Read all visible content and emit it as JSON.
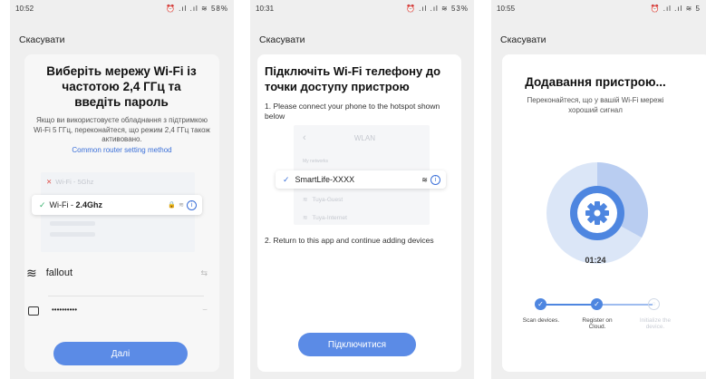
{
  "screen1": {
    "status_time": "10:52",
    "status_icons": "⏰ .ıl .ıl ≋ 58%",
    "cancel": "Скасувати",
    "title": "Виберіть мережу Wi-Fi із частотою 2,4 ГГц та введіть пароль",
    "description": "Якщо ви використовуєте обладнання з підтримкою Wi-Fi 5 ГГц, переконайтеся, що режим 2,4 ГГц також активовано.",
    "router_link": "Common router setting method",
    "wifi_5g_label": "Wi-Fi - 5Ghz",
    "wifi_24g_prefix": "Wi-Fi - ",
    "wifi_24g_band": "2.4Ghz",
    "ssid_value": "fallout",
    "password_value": "••••••••••",
    "next_button": "Далі"
  },
  "screen2": {
    "status_time": "10:31",
    "status_icons": "⏰ .ıl .ıl ≋ 53%",
    "cancel": "Скасувати",
    "title": "Підключіть Wi-Fi телефону до точки доступу пристрою",
    "step1": "1. Please connect your phone to the hotspot shown below",
    "wlan_header": "WLAN",
    "my_networks": "My networks",
    "hotspot_name": "SmartLife-XXXX",
    "network_2": "Tuya-Guest",
    "network_3": "Tuya-Internet",
    "step2": "2. Return to this app and continue adding devices",
    "connect_button": "Підключитися"
  },
  "screen3": {
    "status_time": "10:55",
    "status_icons": "⏰ .ıl .ıl ≋ 5",
    "cancel": "Скасувати",
    "title": "Додавання пристрою...",
    "subtitle": "Переконайтеся, що у вашій Wi-Fi мережі хороший сигнал",
    "timer": "01:24",
    "progress_fraction": 0.33,
    "steps": [
      "Scan devices.",
      "Register on Cloud.",
      "Initialize the device."
    ],
    "steps_done": 2
  },
  "colors": {
    "accent": "#5b8be6",
    "check": "#3ab36f",
    "link": "#3a6fd8"
  }
}
